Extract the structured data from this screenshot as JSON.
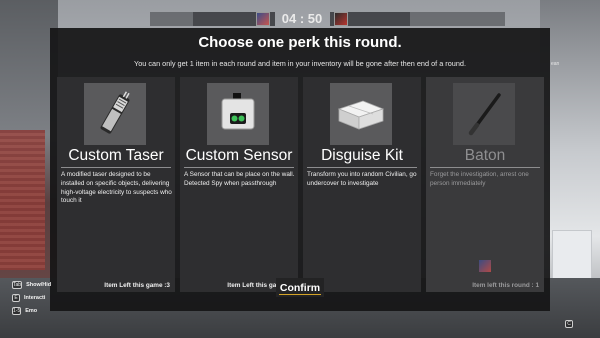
{
  "hud": {
    "timer": "04 : 50"
  },
  "modal": {
    "title": "Choose one perk this round.",
    "subtitle": "You can only get 1 item in each round and item in your inventory will be gone after then end of a round."
  },
  "cards": [
    {
      "name": "Custom Taser",
      "description": "A modified taser designed to be installed on specific objects, delivering high-voltage electricity to suspects who touch it",
      "footer": "Item Left this game :3",
      "icon": "taser-icon",
      "disabled": false
    },
    {
      "name": "Custom Sensor",
      "description": "A Sensor that can be place on the wall. Detected Spy when passthrough",
      "footer": "Item Left this game :2",
      "icon": "sensor-icon",
      "disabled": false
    },
    {
      "name": "Disguise Kit",
      "description": "Transform you into random Civilian, go undercover to investigate",
      "footer": "",
      "icon": "disguise-kit-icon",
      "disabled": false
    },
    {
      "name": "Baton",
      "description": "Forget the investigation, arrest one person immediately",
      "footer": "Item left this round : 1",
      "icon": "baton-icon",
      "disabled": true
    }
  ],
  "confirm_label": "Confirm",
  "hints": [
    {
      "key": "Tab",
      "label": "Show/Hid"
    },
    {
      "key": "E",
      "label": "Interacti"
    },
    {
      "key": "1-5",
      "label": "Emo"
    }
  ],
  "side_label": "ean",
  "bottom_right_key": "C"
}
